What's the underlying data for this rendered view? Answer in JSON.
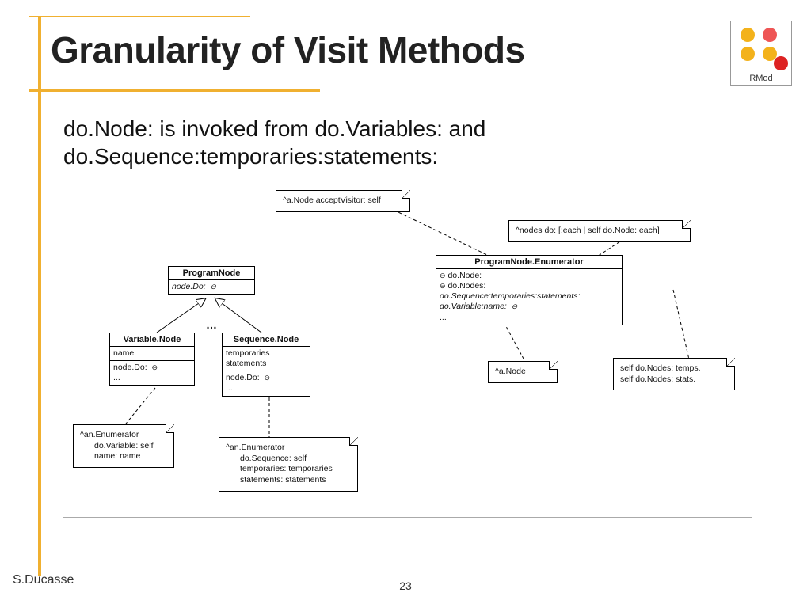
{
  "logo": {
    "label": "RMod"
  },
  "title": "Granularity of Visit Methods",
  "body": "do.Node: is invoked from do.Variables: and do.Sequence:temporaries:statements:",
  "footer": {
    "author": "S.Ducasse",
    "page": "23"
  },
  "diagram": {
    "note_accept": "^a.Node acceptVisitor: self",
    "note_doeach": "^nodes do: [:each | self do.Node: each]",
    "note_anode": "^a.Node",
    "note_selfdo_l1": "self do.Nodes: temps.",
    "note_selfdo_l2": "self do.Nodes: stats.",
    "note_enum_var_l1": "^an.Enumerator",
    "note_enum_var_l2": "do.Variable: self",
    "note_enum_var_l3": "name: name",
    "note_enum_seq_l1": "^an.Enumerator",
    "note_enum_seq_l2": "do.Sequence: self",
    "note_enum_seq_l3": "temporaries: temporaries",
    "note_enum_seq_l4": "statements: statements",
    "program_node": {
      "title": "ProgramNode",
      "m1": "node.Do:"
    },
    "variable_node": {
      "title": "Variable.Node",
      "a1": "name",
      "m1": "node.Do:",
      "m2": "..."
    },
    "sequence_node": {
      "title": "Sequence.Node",
      "a1": "temporaries",
      "a2": "statements",
      "m1": "node.Do:",
      "m2": "..."
    },
    "enumerator": {
      "title": "ProgramNode.Enumerator",
      "m1": "do.Node:",
      "m2": "do.Nodes:",
      "m3": "do.Sequence:temporaries:statements:",
      "m4": "do.Variable:name:",
      "m5": "..."
    },
    "ellipsis": "…"
  }
}
